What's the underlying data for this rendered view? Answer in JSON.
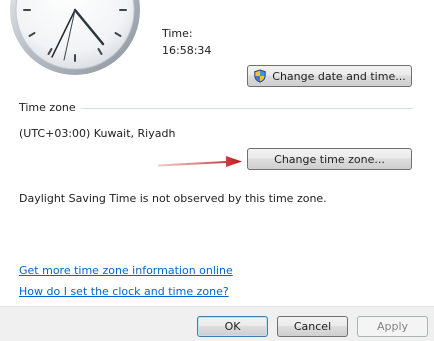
{
  "clock": {
    "time_label": "Time:",
    "time_value": "16:58:34",
    "change_datetime_label": "Change date and time...",
    "change_datetime_icon": "uac-shield-icon"
  },
  "timezone": {
    "group_label": "Time zone",
    "current": "(UTC+03:00) Kuwait, Riyadh",
    "change_label": "Change time zone...",
    "dst_note": "Daylight Saving Time is not observed by this time zone."
  },
  "links": {
    "more_info": "Get more time zone information online",
    "how_to": "How do I set the clock and time zone?"
  },
  "footer": {
    "ok": "OK",
    "cancel": "Cancel",
    "apply": "Apply"
  },
  "colors": {
    "annotation_arrow": "#c0141c",
    "link": "#0066cc"
  }
}
